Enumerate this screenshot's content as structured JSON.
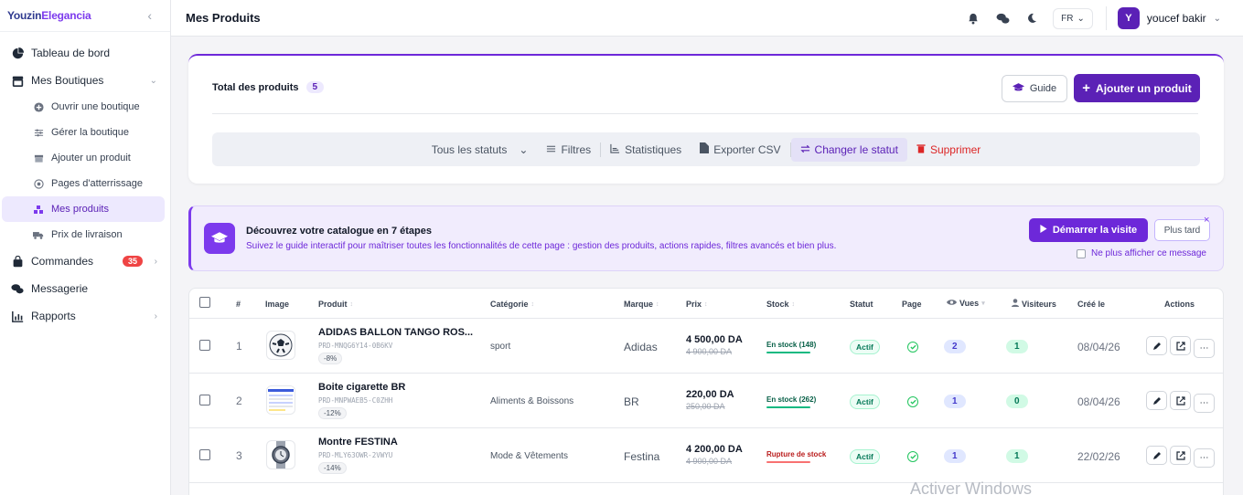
{
  "brand": {
    "part1": "Youzin",
    "part2": "Elegancia"
  },
  "sidebar": {
    "items": [
      {
        "label": "Tableau de bord"
      },
      {
        "label": "Mes Boutiques"
      },
      {
        "label": "Ouvrir une boutique"
      },
      {
        "label": "Gérer la boutique"
      },
      {
        "label": "Ajouter un produit"
      },
      {
        "label": "Pages d'atterrissage"
      },
      {
        "label": "Mes produits"
      },
      {
        "label": "Prix de livraison"
      },
      {
        "label": "Commandes",
        "badge": "35"
      },
      {
        "label": "Messagerie"
      },
      {
        "label": "Rapports"
      }
    ]
  },
  "topbar": {
    "title": "Mes Produits",
    "lang": "FR",
    "avatar": "Y",
    "user": "youcef bakir"
  },
  "summary": {
    "total_label": "Total des produits",
    "total_count": "5",
    "guide_label": "Guide",
    "add_label": "Ajouter un produit"
  },
  "toolbar": {
    "status": "Tous les statuts",
    "filters": "Filtres",
    "stats": "Statistiques",
    "export": "Exporter CSV",
    "change_status": "Changer le statut",
    "delete": "Supprimer"
  },
  "banner": {
    "title": "Découvrez votre catalogue en 7 étapes",
    "subtitle": "Suivez le guide interactif pour maîtriser toutes les fonctionnalités de cette page : gestion des produits, actions rapides, filtres avancés et bien plus.",
    "start": "Démarrer la visite",
    "later": "Plus tard",
    "no_show": "Ne plus afficher ce message"
  },
  "table": {
    "headers": {
      "num": "#",
      "image": "Image",
      "product": "Produit",
      "category": "Catégorie",
      "brand": "Marque",
      "price": "Prix",
      "stock": "Stock",
      "status": "Statut",
      "page": "Page",
      "views": "Vues",
      "visitors": "Visiteurs",
      "created": "Créé le",
      "actions": "Actions"
    },
    "rows": [
      {
        "num": "1",
        "name": "ADIDAS BALLON TANGO ROS...",
        "sku": "PRD-MNQG6Y14-0B6KV",
        "discount": "-8%",
        "category": "sport",
        "brand": "Adidas",
        "price": "4 500,00 DA",
        "old_price": "4 900,00 DA",
        "stock": "En stock (148)",
        "stock_state": "in",
        "status": "Actif",
        "views": "2",
        "visitors": "1",
        "created": "08/04/26",
        "thumb": "ball"
      },
      {
        "num": "2",
        "name": "Boite cigarette BR",
        "sku": "PRD-MNPWAEB5-C0ZHH",
        "discount": "-12%",
        "category": "Aliments & Boissons",
        "brand": "BR",
        "price": "220,00 DA",
        "old_price": "250,00 DA",
        "stock": "En stock (262)",
        "stock_state": "in",
        "status": "Actif",
        "views": "1",
        "visitors": "0",
        "created": "08/04/26",
        "thumb": "screen"
      },
      {
        "num": "3",
        "name": "Montre FESTINA",
        "sku": "PRD-MLY63OWR-2VWYU",
        "discount": "-14%",
        "category": "Mode & Vêtements",
        "brand": "Festina",
        "price": "4 200,00 DA",
        "old_price": "4 900,00 DA",
        "stock": "Rupture de stock",
        "stock_state": "out",
        "status": "Actif",
        "views": "1",
        "visitors": "1",
        "created": "22/02/26",
        "thumb": "watch"
      }
    ]
  },
  "watermark": "Activer Windows"
}
